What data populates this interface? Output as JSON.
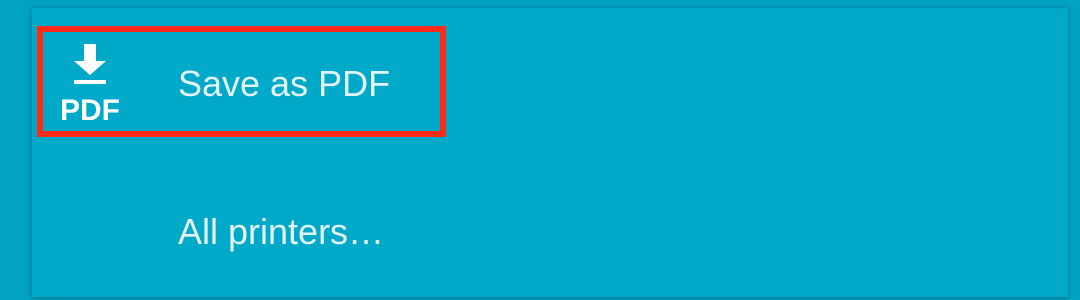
{
  "menu": {
    "items": [
      {
        "label": "Save as PDF",
        "icon": "pdf-download-icon",
        "icon_text": "PDF"
      },
      {
        "label": "All printers…"
      }
    ]
  },
  "colors": {
    "background": "#00A3C2",
    "panel": "#00A9C8",
    "text": "#E3F4F8",
    "highlight": "#FF2A17"
  }
}
